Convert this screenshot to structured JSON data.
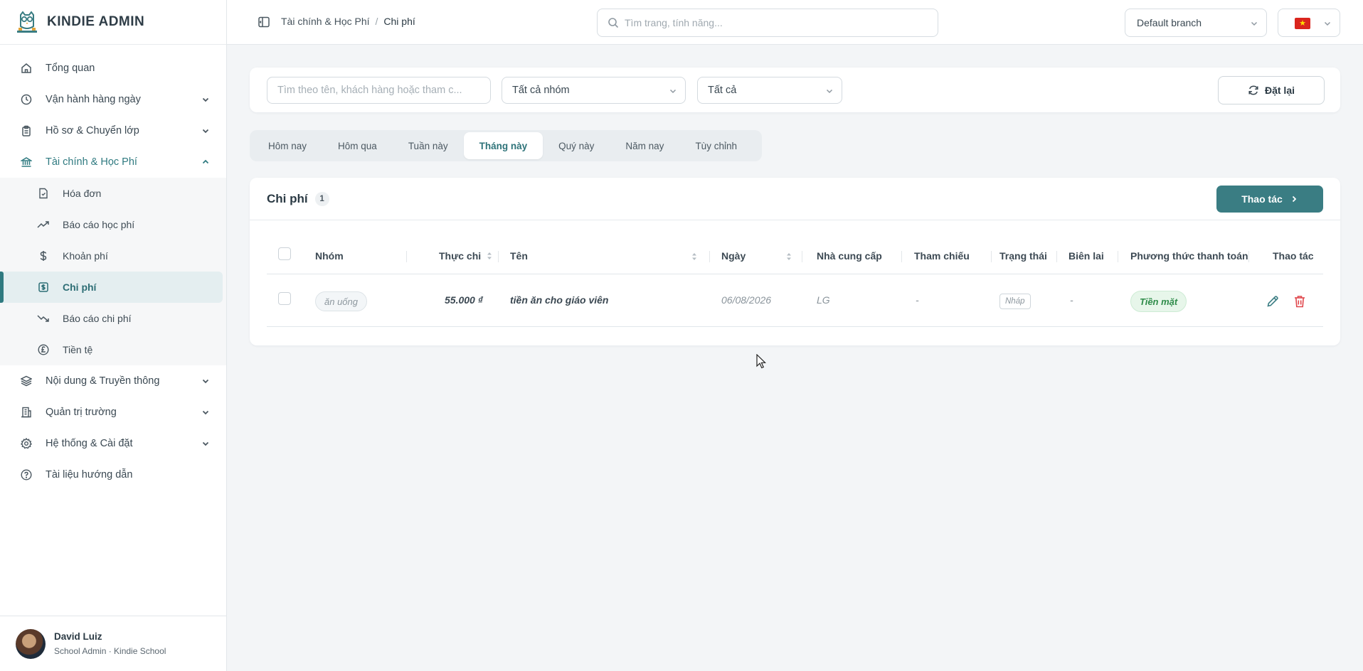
{
  "brand": {
    "name": "KINDIE ADMIN"
  },
  "sidebar": {
    "items": [
      {
        "label": "Tổng quan",
        "icon": "home-icon"
      },
      {
        "label": "Vận hành hàng ngày",
        "icon": "clock-icon"
      },
      {
        "label": "Hồ sơ & Chuyển lớp",
        "icon": "clipboard-icon"
      },
      {
        "label": "Tài chính & Học Phí",
        "icon": "bank-icon"
      },
      {
        "label": "Nội dung & Truyền thông",
        "icon": "layers-icon"
      },
      {
        "label": "Quản trị trường",
        "icon": "building-icon"
      },
      {
        "label": "Hệ thống & Cài đặt",
        "icon": "gear-icon"
      },
      {
        "label": "Tài liệu hướng dẫn",
        "icon": "help-circle-icon"
      }
    ],
    "finance_sub": [
      {
        "label": "Hóa đơn",
        "icon": "invoice-icon"
      },
      {
        "label": "Báo cáo học phí",
        "icon": "trending-up-icon"
      },
      {
        "label": "Khoản phí",
        "icon": "dollar-icon"
      },
      {
        "label": "Chi phí",
        "icon": "receipt-dollar-icon"
      },
      {
        "label": "Báo cáo chi phí",
        "icon": "trending-down-icon"
      },
      {
        "label": "Tiền tệ",
        "icon": "pound-icon"
      }
    ]
  },
  "user": {
    "name": "David Luiz",
    "role": "School Admin · Kindie School"
  },
  "topbar": {
    "breadcrumb_parent": "Tài chính & Học Phí",
    "breadcrumb_sep": "/",
    "breadcrumb_current": "Chi phí",
    "search_placeholder": "Tìm trang, tính năng...",
    "branch": "Default branch"
  },
  "filters": {
    "search_placeholder": "Tìm theo tên, khách hàng hoặc tham c...",
    "group": "Tất cả nhóm",
    "status": "Tất cả",
    "reset_label": "Đặt lại"
  },
  "periods": {
    "tabs": [
      "Hôm nay",
      "Hôm qua",
      "Tuần này",
      "Tháng này",
      "Quý này",
      "Năm nay",
      "Tùy chỉnh"
    ],
    "active": "Tháng này"
  },
  "card": {
    "title": "Chi phí",
    "count": "1",
    "action_label": "Thao tác"
  },
  "table": {
    "headers": {
      "group": "Nhóm",
      "amount": "Thực chi",
      "name": "Tên",
      "date": "Ngày",
      "supplier": "Nhà cung cấp",
      "reference": "Tham chiếu",
      "status": "Trạng thái",
      "receipt": "Biên lai",
      "payment": "Phương thức thanh toán",
      "actions": "Thao tác"
    },
    "rows": [
      {
        "group": "ăn uống",
        "amount": "55.000 ₫",
        "name": "tiền ăn cho giáo viên",
        "date": "06/08/2026",
        "supplier": "LG",
        "reference": "-",
        "status": "Nháp",
        "receipt": "-",
        "payment": "Tiền mặt"
      }
    ]
  },
  "colors": {
    "accent": "#3a7d83",
    "danger": "#e0474c",
    "success": "#2f8c4a"
  }
}
